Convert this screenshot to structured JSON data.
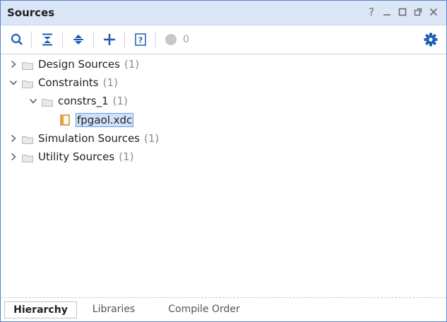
{
  "window": {
    "title": "Sources",
    "controls": {
      "help": "?",
      "minimize": "_",
      "maximize": "□",
      "float": "⧉",
      "close": "✕"
    }
  },
  "toolbar": {
    "search_icon": "search-icon",
    "collapse_all_icon": "collapse-all-icon",
    "expand_all_icon": "expand-all-icon",
    "add_icon": "add-icon",
    "help_icon": "question-box-icon",
    "status_icon": "status-dot-icon",
    "status_count": "0",
    "settings_icon": "gear-icon"
  },
  "tree": {
    "items": [
      {
        "label": "Design Sources",
        "count": "(1)",
        "expanded": false
      },
      {
        "label": "Constraints",
        "count": "(1)",
        "expanded": true
      },
      {
        "label": "constrs_1",
        "count": "(1)",
        "expanded": true
      },
      {
        "label": "fpgaol.xdc",
        "selected": true
      },
      {
        "label": "Simulation Sources",
        "count": "(1)",
        "expanded": false
      },
      {
        "label": "Utility Sources",
        "count": "(1)",
        "expanded": false
      }
    ]
  },
  "tabs": [
    {
      "label": "Hierarchy",
      "active": true
    },
    {
      "label": "Libraries",
      "active": false
    },
    {
      "label": "Compile Order",
      "active": false
    }
  ],
  "colors": {
    "titlebar": "#dbe6f6",
    "border": "#5b84c9",
    "accent": "#1f5eb5",
    "selection": "#cfe2fb"
  }
}
